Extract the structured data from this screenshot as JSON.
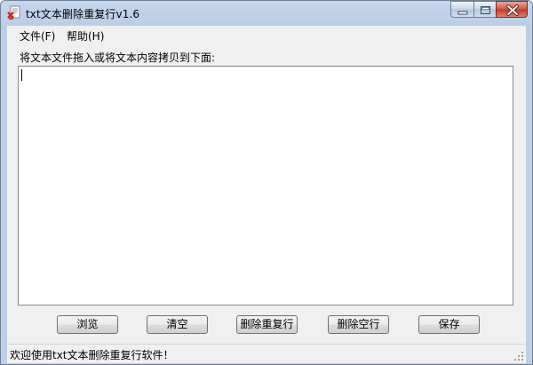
{
  "window": {
    "title": "txt文本删除重复行v1.6"
  },
  "menu": {
    "file": "文件(F)",
    "help": "帮助(H)"
  },
  "main": {
    "prompt": "将文本文件拖入或将文本内容拷贝到下面:",
    "text_value": ""
  },
  "buttons": {
    "browse": "浏览",
    "clear": "清空",
    "remove_duplicates": "删除重复行",
    "remove_blank": "删除空行",
    "save": "保存"
  },
  "status": {
    "text": "欢迎使用txt文本删除重复行软件！"
  },
  "icons": {
    "app": "app-icon",
    "minimize": "minimize-icon",
    "maximize": "maximize-icon",
    "close": "close-icon",
    "resize": "resize-grip-icon"
  }
}
